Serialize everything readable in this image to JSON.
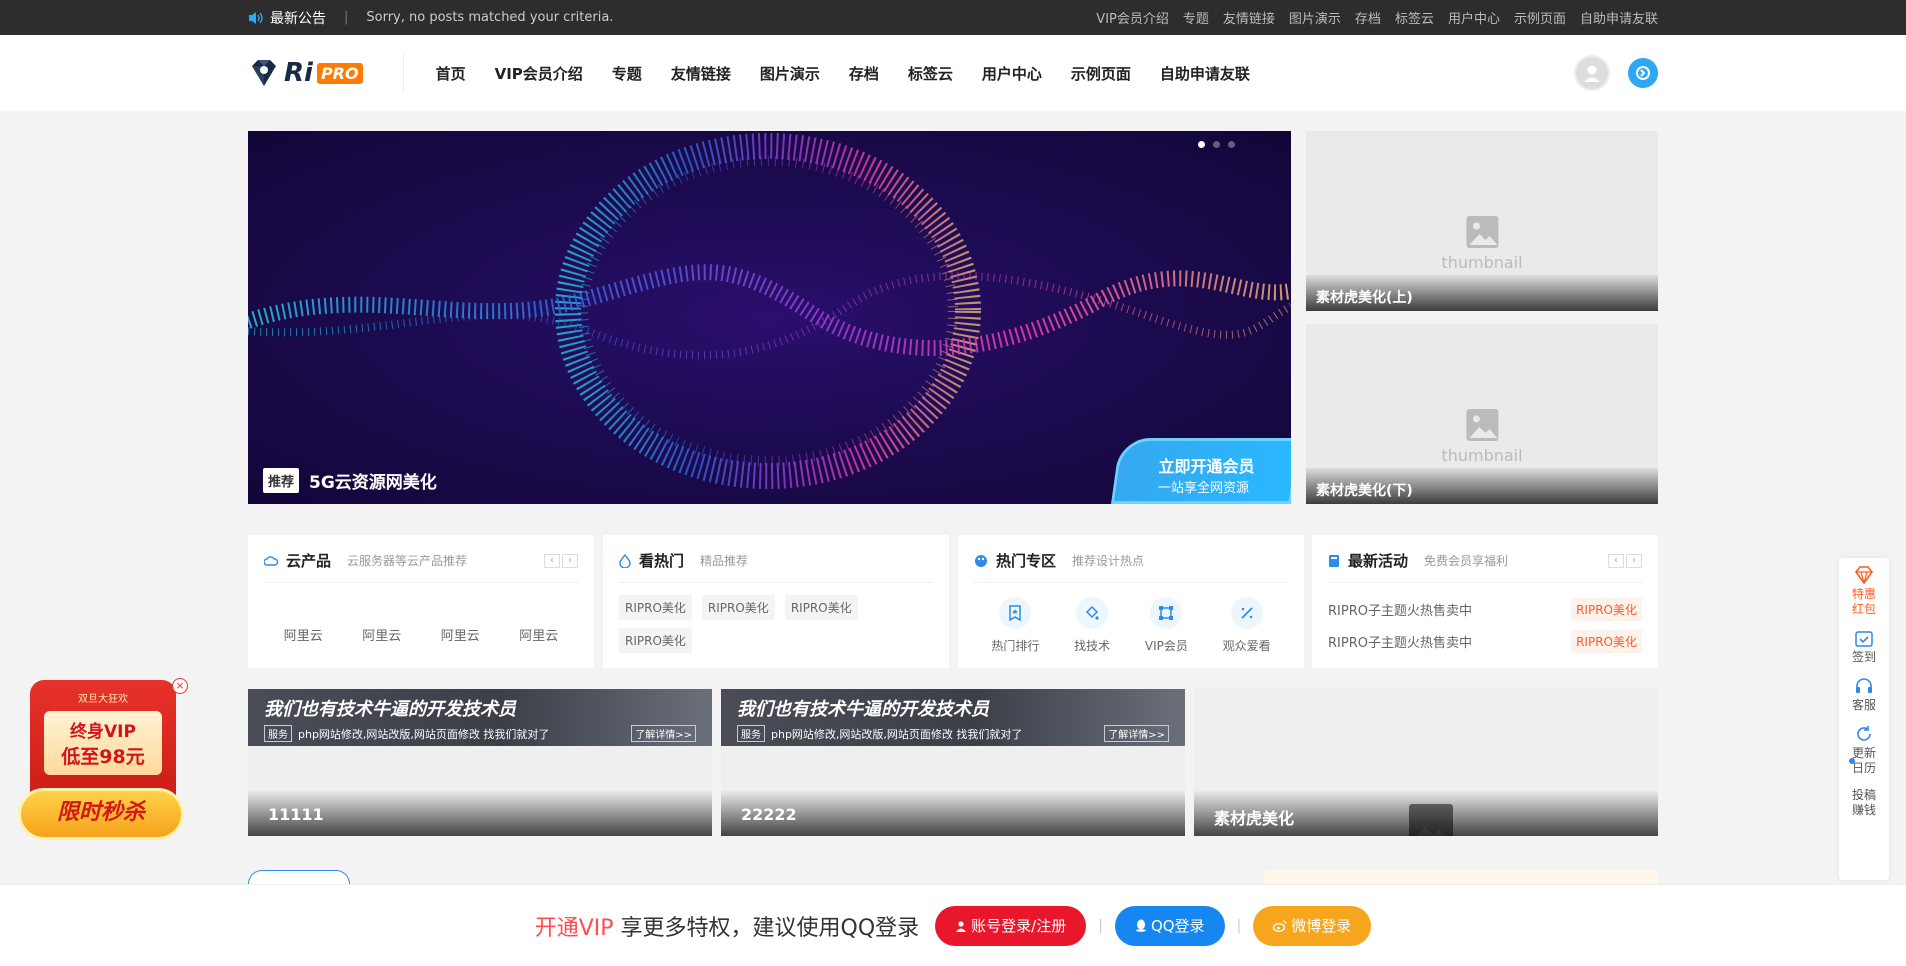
{
  "topbar": {
    "notice_title": "最新公告",
    "notice_text": "Sorry, no posts matched your criteria.",
    "links": [
      "VIP会员介绍",
      "专题",
      "友情链接",
      "图片演示",
      "存档",
      "标签云",
      "用户中心",
      "示例页面",
      "自助申请友联"
    ]
  },
  "header": {
    "logo_ri": "Ri",
    "logo_pro": "PRO",
    "nav": [
      "首页",
      "VIP会员介绍",
      "专题",
      "友情链接",
      "图片演示",
      "存档",
      "标签云",
      "用户中心",
      "示例页面",
      "自助申请友联"
    ]
  },
  "slider": {
    "badge": "推荐",
    "title": "5G云资源网美化",
    "promo_line1": "立即开通会员",
    "promo_line2": "一站享全网资源"
  },
  "thumbs": [
    {
      "placeholder": "thumbnail",
      "caption": "素材虎美化(上)"
    },
    {
      "placeholder": "thumbnail",
      "caption": "素材虎美化(下)"
    }
  ],
  "boxes": {
    "cloud": {
      "title": "云产品",
      "subtitle": "云服务器等云产品推荐",
      "items": [
        "阿里云",
        "阿里云",
        "阿里云",
        "阿里云"
      ]
    },
    "hot": {
      "title": "看热门",
      "subtitle": "精品推荐",
      "tags": [
        "RIPRO美化",
        "RIPRO美化",
        "RIPRO美化",
        "RIPRO美化"
      ]
    },
    "zone": {
      "title": "热门专区",
      "subtitle": "推荐设计热点",
      "items": [
        "热门排行",
        "找技术",
        "VIP会员",
        "观众爱看"
      ]
    },
    "activity": {
      "title": "最新活动",
      "subtitle": "免费会员享福利",
      "rows": [
        {
          "text": "RIPRO子主题火热售卖中",
          "label": "RIPRO美化"
        },
        {
          "text": "RIPRO子主题火热售卖中",
          "label": "RIPRO美化"
        }
      ]
    },
    "arrows": {
      "prev": "‹",
      "next": "›"
    }
  },
  "features": [
    {
      "banner_title": "我们也有技术牛逼的开发技术员",
      "banner_tag": "服务",
      "banner_desc": "php网站修改,网站改版,网站页面修改 找我们就对了",
      "banner_more": "了解详情>>",
      "caption": "11111"
    },
    {
      "banner_title": "我们也有技术牛逼的开发技术员",
      "banner_tag": "服务",
      "banner_desc": "php网站修改,网站改版,网站页面修改 找我们就对了",
      "banner_more": "了解详情>>",
      "caption": "22222"
    },
    {
      "caption": "素材虎美化"
    }
  ],
  "float_promo": {
    "top": "双旦大狂欢",
    "line1": "终身VIP",
    "line2": "低至98元",
    "button": "限时秒杀",
    "close": "×"
  },
  "side_bar": [
    {
      "label": "特惠红包"
    },
    {
      "label": "签到"
    },
    {
      "label": "客服"
    },
    {
      "label": "更新日历"
    },
    {
      "label": "投稿赚钱"
    }
  ],
  "bottom_bar": {
    "msg_vip": "开通VIP",
    "msg_rest": "享更多特权，建议使用QQ登录",
    "btn_account": "账号登录/注册",
    "btn_qq": "QQ登录",
    "btn_weibo": "微博登录",
    "pipe": "|"
  },
  "colors": {
    "accent_blue": "#2ea7f5",
    "brand_orange": "#ff7a00",
    "login_red": "#e8172c",
    "qq_blue": "#1687f0",
    "weibo_orange": "#f7a51c"
  }
}
